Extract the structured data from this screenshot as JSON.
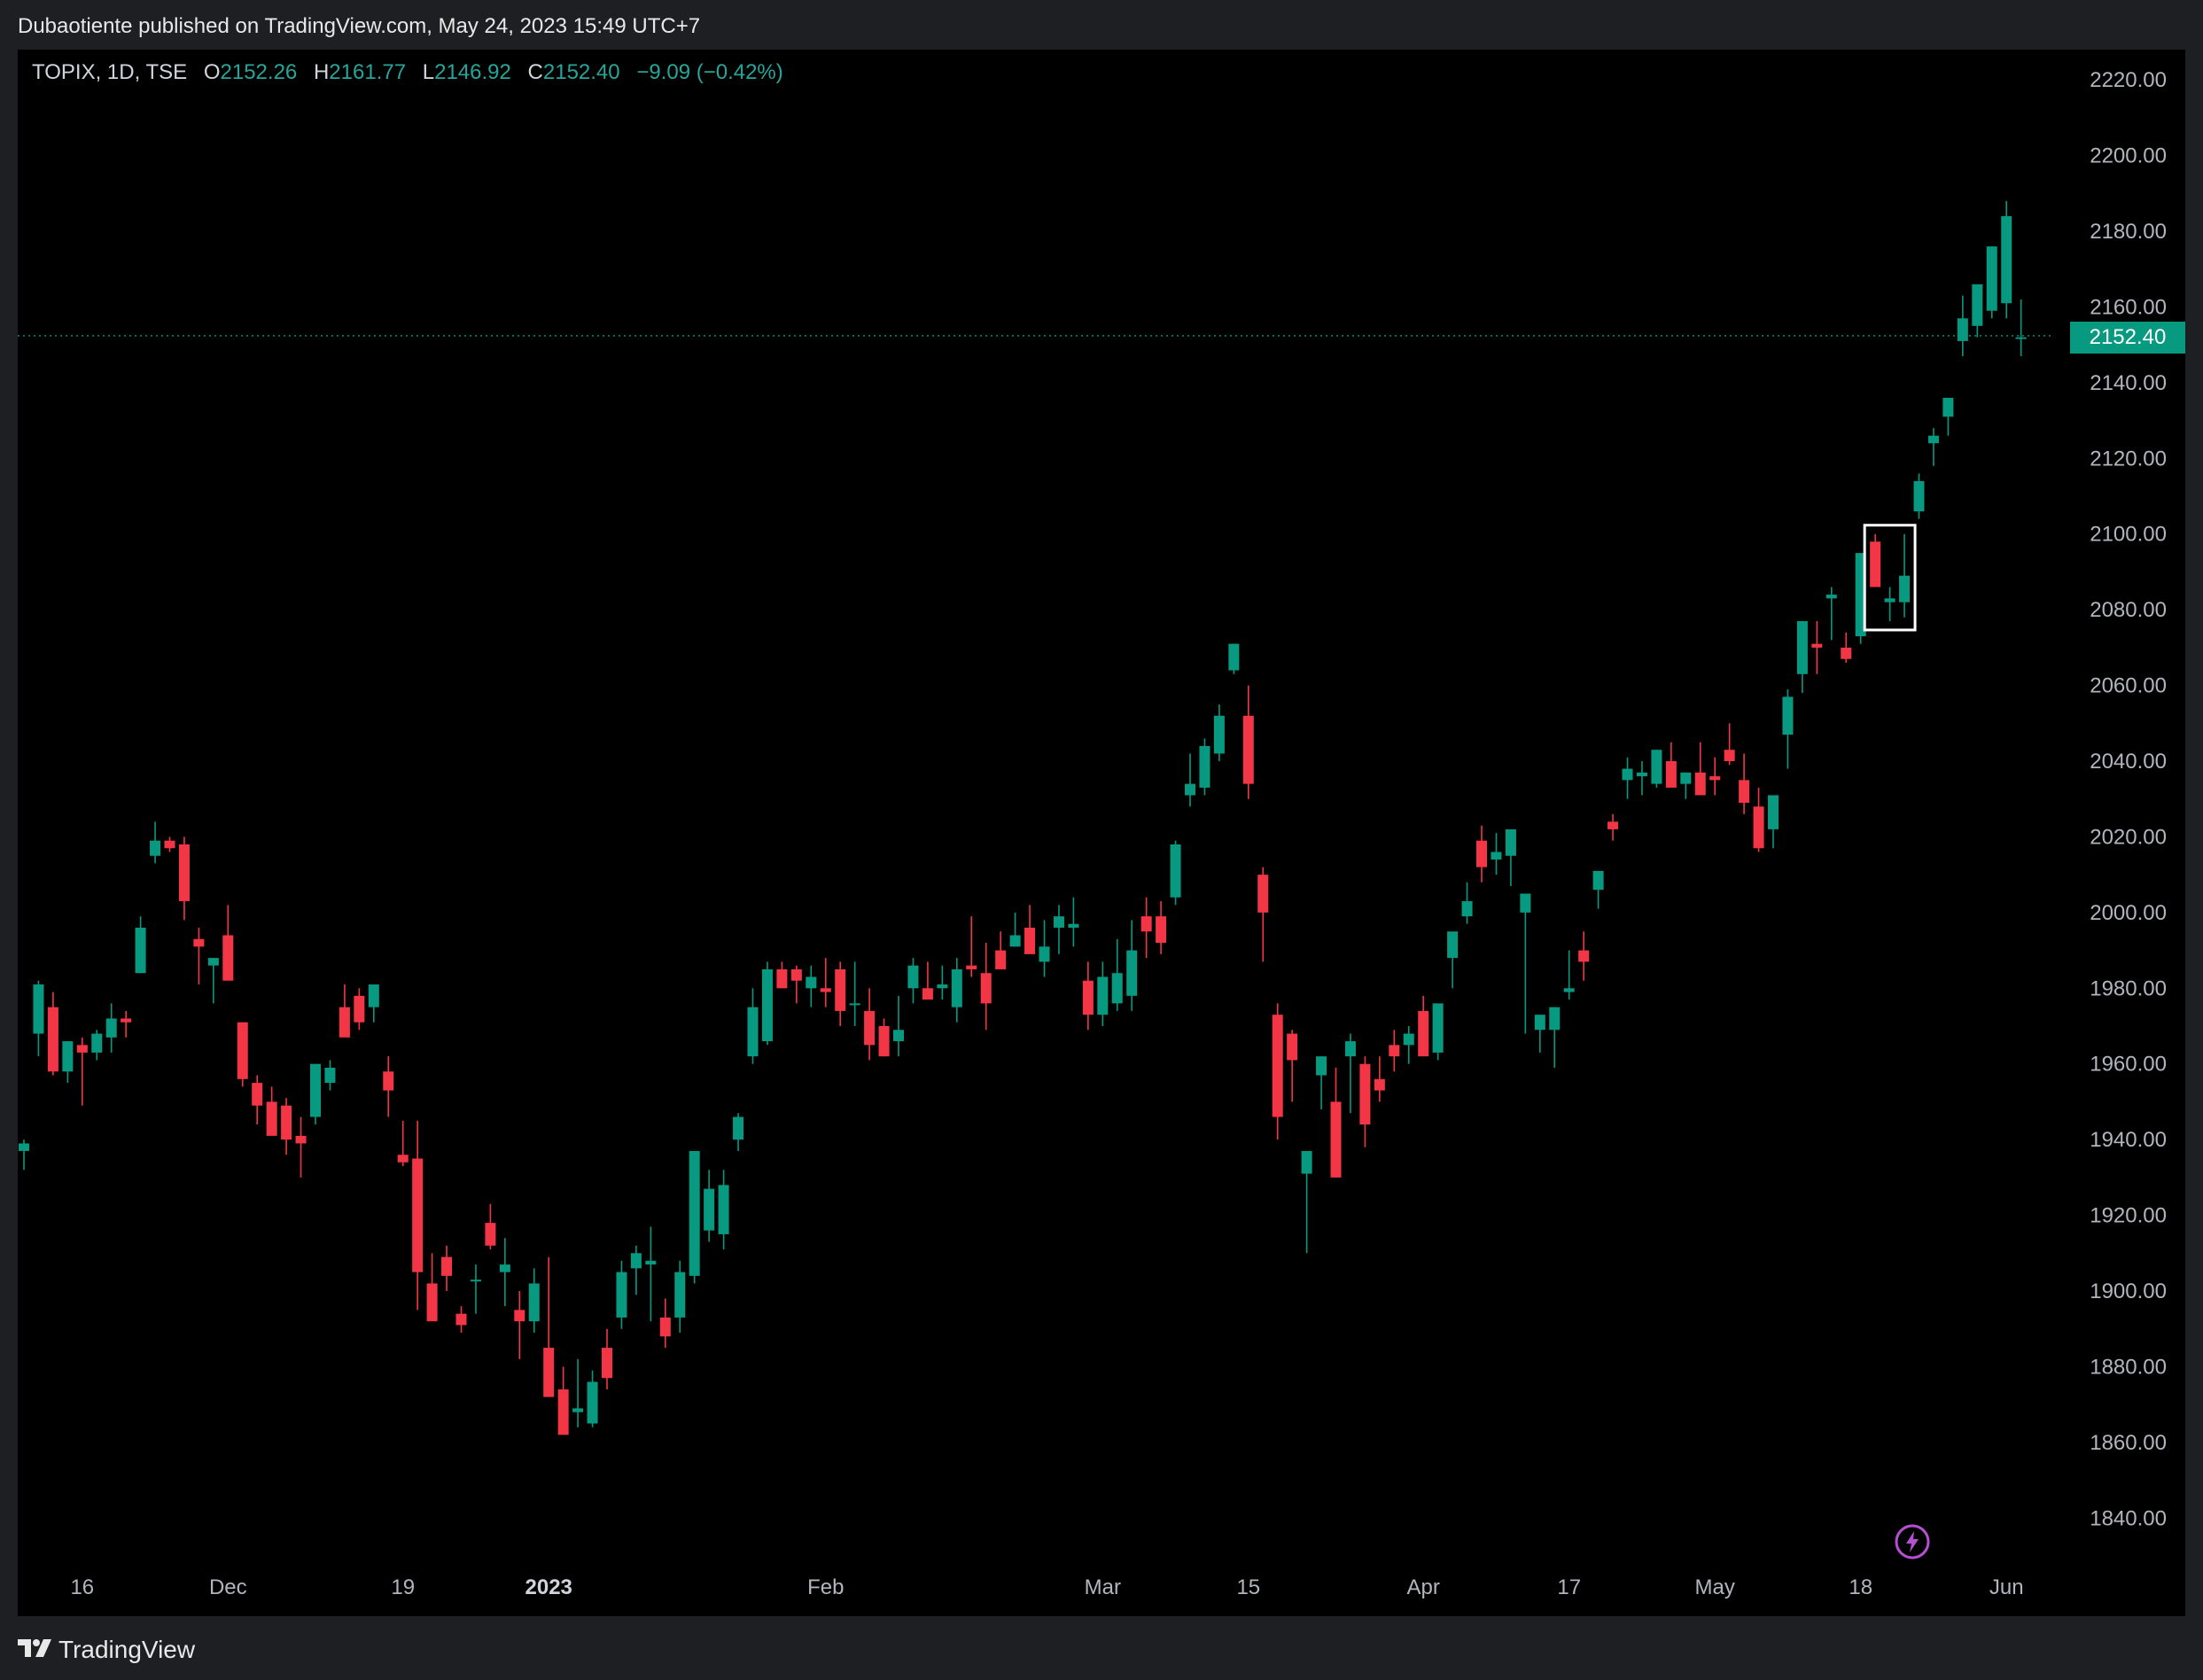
{
  "header": {
    "publish_text": "Dubaotiente published on TradingView.com, May 24, 2023 15:49 UTC+7"
  },
  "legend": {
    "symbol": "TOPIX, 1D, TSE",
    "open_label": "O",
    "open": "2152.26",
    "high_label": "H",
    "high": "2161.77",
    "low_label": "L",
    "low": "2146.92",
    "close_label": "C",
    "close": "2152.40",
    "change": "−9.09 (−0.42%)"
  },
  "price_tag": "2152.40",
  "footer": {
    "brand": "TradingView"
  },
  "icons": {
    "logo": "tradingview-logo-icon",
    "flash": "lightning-icon"
  },
  "colors": {
    "up": "#089981",
    "down": "#f23645",
    "background": "#000000",
    "tag": "#089981"
  },
  "chart_data": {
    "type": "candlestick",
    "symbol": "TOPIX",
    "interval": "1D",
    "exchange": "TSE",
    "ylim": [
      1830,
      2228
    ],
    "y_ticks": [
      "2220.00",
      "2200.00",
      "2180.00",
      "2160.00",
      "2140.00",
      "2120.00",
      "2100.00",
      "2080.00",
      "2060.00",
      "2040.00",
      "2020.00",
      "2000.00",
      "1980.00",
      "1960.00",
      "1940.00",
      "1920.00",
      "1900.00",
      "1880.00",
      "1860.00",
      "1840.00"
    ],
    "x_ticks": [
      {
        "label": "16",
        "i": 4,
        "bold": false
      },
      {
        "label": "Dec",
        "i": 14,
        "bold": false
      },
      {
        "label": "19",
        "i": 26,
        "bold": false
      },
      {
        "label": "2023",
        "i": 36,
        "bold": true
      },
      {
        "label": "Feb",
        "i": 55,
        "bold": false
      },
      {
        "label": "Mar",
        "i": 74,
        "bold": false
      },
      {
        "label": "15",
        "i": 84,
        "bold": false
      },
      {
        "label": "Apr",
        "i": 96,
        "bold": false
      },
      {
        "label": "17",
        "i": 106,
        "bold": false
      },
      {
        "label": "May",
        "i": 116,
        "bold": false
      },
      {
        "label": "18",
        "i": 126,
        "bold": false
      },
      {
        "label": "Jun",
        "i": 136,
        "bold": false
      }
    ],
    "last_price": 2152.4,
    "highlight_range": [
      127,
      129
    ],
    "candles": [
      [
        1937,
        1940,
        1932,
        1939
      ],
      [
        1968,
        1982,
        1962,
        1981
      ],
      [
        1975,
        1979,
        1957,
        1958
      ],
      [
        1958,
        1966,
        1955,
        1966
      ],
      [
        1965,
        1967,
        1949,
        1963
      ],
      [
        1963,
        1969,
        1961,
        1968
      ],
      [
        1967,
        1976,
        1963,
        1972
      ],
      [
        1972,
        1974,
        1967,
        1971
      ],
      [
        1984,
        1999,
        1984,
        1996
      ],
      [
        2015,
        2024,
        2013,
        2019
      ],
      [
        2019,
        2020,
        2016,
        2017
      ],
      [
        2018,
        2020,
        1998,
        2003
      ],
      [
        1993,
        1996,
        1981,
        1991
      ],
      [
        1986,
        1988,
        1976,
        1988
      ],
      [
        1994,
        2002,
        1986,
        1982
      ],
      [
        1971,
        1971,
        1954,
        1956
      ],
      [
        1955,
        1957,
        1944,
        1949
      ],
      [
        1950,
        1954,
        1943,
        1941
      ],
      [
        1949,
        1951,
        1936,
        1940
      ],
      [
        1941,
        1946,
        1930,
        1939
      ],
      [
        1946,
        1960,
        1944,
        1960
      ],
      [
        1955,
        1961,
        1953,
        1959
      ],
      [
        1975,
        1981,
        1971,
        1967
      ],
      [
        1978,
        1980,
        1969,
        1971
      ],
      [
        1975,
        1981,
        1971,
        1981
      ],
      [
        1958,
        1962,
        1946,
        1953
      ],
      [
        1936,
        1945,
        1933,
        1934
      ],
      [
        1935,
        1945,
        1895,
        1905
      ],
      [
        1902,
        1910,
        1896,
        1892
      ],
      [
        1909,
        1912,
        1900,
        1904
      ],
      [
        1894,
        1896,
        1889,
        1891
      ],
      [
        1903,
        1907,
        1894,
        1903
      ],
      [
        1918,
        1923,
        1911,
        1912
      ],
      [
        1905,
        1914,
        1896,
        1907
      ],
      [
        1895,
        1900,
        1882,
        1892
      ],
      [
        1892,
        1906,
        1889,
        1902
      ],
      [
        1885,
        1909,
        1875,
        1872
      ],
      [
        1874,
        1880,
        1862,
        1862
      ],
      [
        1868,
        1882,
        1864,
        1869
      ],
      [
        1865,
        1879,
        1864,
        1876
      ],
      [
        1885,
        1890,
        1874,
        1877
      ],
      [
        1893,
        1908,
        1890,
        1905
      ],
      [
        1906,
        1912,
        1899,
        1910
      ],
      [
        1907,
        1917,
        1892,
        1908
      ],
      [
        1893,
        1898,
        1885,
        1888
      ],
      [
        1893,
        1908,
        1889,
        1905
      ],
      [
        1904,
        1936,
        1902,
        1937
      ],
      [
        1916,
        1932,
        1913,
        1927
      ],
      [
        1915,
        1932,
        1911,
        1928
      ],
      [
        1940,
        1947,
        1937,
        1946
      ],
      [
        1962,
        1980,
        1960,
        1975
      ],
      [
        1966,
        1987,
        1965,
        1985
      ],
      [
        1985,
        1987,
        1980,
        1980
      ],
      [
        1985,
        1986,
        1976,
        1982
      ],
      [
        1980,
        1986,
        1975,
        1983
      ],
      [
        1980,
        1988,
        1975,
        1979
      ],
      [
        1985,
        1987,
        1970,
        1974
      ],
      [
        1976,
        1987,
        1970,
        1976
      ],
      [
        1974,
        1980,
        1961,
        1965
      ],
      [
        1970,
        1972,
        1962,
        1962
      ],
      [
        1966,
        1978,
        1962,
        1969
      ],
      [
        1980,
        1988,
        1976,
        1986
      ],
      [
        1980,
        1987,
        1978,
        1977
      ],
      [
        1980,
        1986,
        1977,
        1981
      ],
      [
        1975,
        1988,
        1971,
        1985
      ],
      [
        1986,
        1999,
        1983,
        1985
      ],
      [
        1984,
        1992,
        1969,
        1976
      ],
      [
        1990,
        1995,
        1986,
        1985
      ],
      [
        1991,
        2000,
        1991,
        1994
      ],
      [
        1996,
        2002,
        1991,
        1989
      ],
      [
        1987,
        1998,
        1983,
        1991
      ],
      [
        1996,
        2002,
        1989,
        1999
      ],
      [
        1996,
        2004,
        1991,
        1997
      ],
      [
        1982,
        1987,
        1969,
        1973
      ],
      [
        1973,
        1987,
        1970,
        1983
      ],
      [
        1976,
        1993,
        1974,
        1984
      ],
      [
        1978,
        1998,
        1974,
        1990
      ],
      [
        1999,
        2004,
        1988,
        1995
      ],
      [
        1999,
        2003,
        1989,
        1992
      ],
      [
        2004,
        2019,
        2002,
        2018
      ],
      [
        2031,
        2042,
        2028,
        2034
      ],
      [
        2033,
        2046,
        2031,
        2044
      ],
      [
        2042,
        2055,
        2040,
        2052
      ],
      [
        2064,
        2071,
        2063,
        2071
      ],
      [
        2052,
        2060,
        2030,
        2034
      ],
      [
        2010,
        2012,
        1987,
        2000
      ],
      [
        1973,
        1976,
        1940,
        1946
      ],
      [
        1968,
        1969,
        1950,
        1961
      ],
      [
        1931,
        1936,
        1910,
        1937
      ],
      [
        1957,
        1962,
        1948,
        1962
      ],
      [
        1950,
        1959,
        1930,
        1930
      ],
      [
        1962,
        1968,
        1947,
        1966
      ],
      [
        1960,
        1962,
        1938,
        1944
      ],
      [
        1956,
        1962,
        1950,
        1953
      ],
      [
        1965,
        1969,
        1958,
        1962
      ],
      [
        1965,
        1970,
        1960,
        1968
      ],
      [
        1974,
        1978,
        1965,
        1962
      ],
      [
        1963,
        1974,
        1961,
        1976
      ],
      [
        1988,
        1991,
        1980,
        1995
      ],
      [
        1999,
        2008,
        1997,
        2003
      ],
      [
        2019,
        2023,
        2008,
        2012
      ],
      [
        2014,
        2021,
        2010,
        2016
      ],
      [
        2015,
        2018,
        2007,
        2022
      ],
      [
        2000,
        2003,
        1968,
        2005
      ],
      [
        1969,
        1970,
        1963,
        1973
      ],
      [
        1969,
        1975,
        1959,
        1975
      ],
      [
        1979,
        1990,
        1977,
        1980
      ],
      [
        1990,
        1995,
        1982,
        1987
      ],
      [
        2006,
        2010,
        2001,
        2011
      ],
      [
        2024,
        2026,
        2019,
        2022
      ],
      [
        2035,
        2041,
        2030,
        2038
      ],
      [
        2036,
        2040,
        2031,
        2037
      ],
      [
        2034,
        2043,
        2033,
        2043
      ],
      [
        2040,
        2045,
        2034,
        2033
      ],
      [
        2034,
        2037,
        2030,
        2037
      ],
      [
        2037,
        2045,
        2031,
        2031
      ],
      [
        2036,
        2041,
        2031,
        2035
      ],
      [
        2043,
        2050,
        2039,
        2040
      ],
      [
        2035,
        2042,
        2026,
        2029
      ],
      [
        2028,
        2033,
        2016,
        2017
      ],
      [
        2022,
        2026,
        2017,
        2031
      ],
      [
        2047,
        2059,
        2038,
        2057
      ],
      [
        2063,
        2070,
        2058,
        2077
      ],
      [
        2071,
        2077,
        2063,
        2070
      ],
      [
        2083,
        2086,
        2072,
        2084
      ],
      [
        2070,
        2074,
        2066,
        2067
      ],
      [
        2073,
        2082,
        2071,
        2095
      ],
      [
        2098,
        2100,
        2087,
        2086
      ],
      [
        2082,
        2086,
        2077,
        2083
      ],
      [
        2082,
        2100,
        2078,
        2089
      ],
      [
        2106,
        2116,
        2104,
        2114
      ],
      [
        2124,
        2128,
        2118,
        2126
      ],
      [
        2131,
        2136,
        2126,
        2136
      ],
      [
        2151,
        2163,
        2147,
        2157
      ],
      [
        2155,
        2163,
        2152,
        2166
      ],
      [
        2159,
        2176,
        2157,
        2176
      ],
      [
        2161,
        2188,
        2157,
        2184
      ],
      [
        2152,
        2162,
        2147,
        2152
      ]
    ]
  }
}
